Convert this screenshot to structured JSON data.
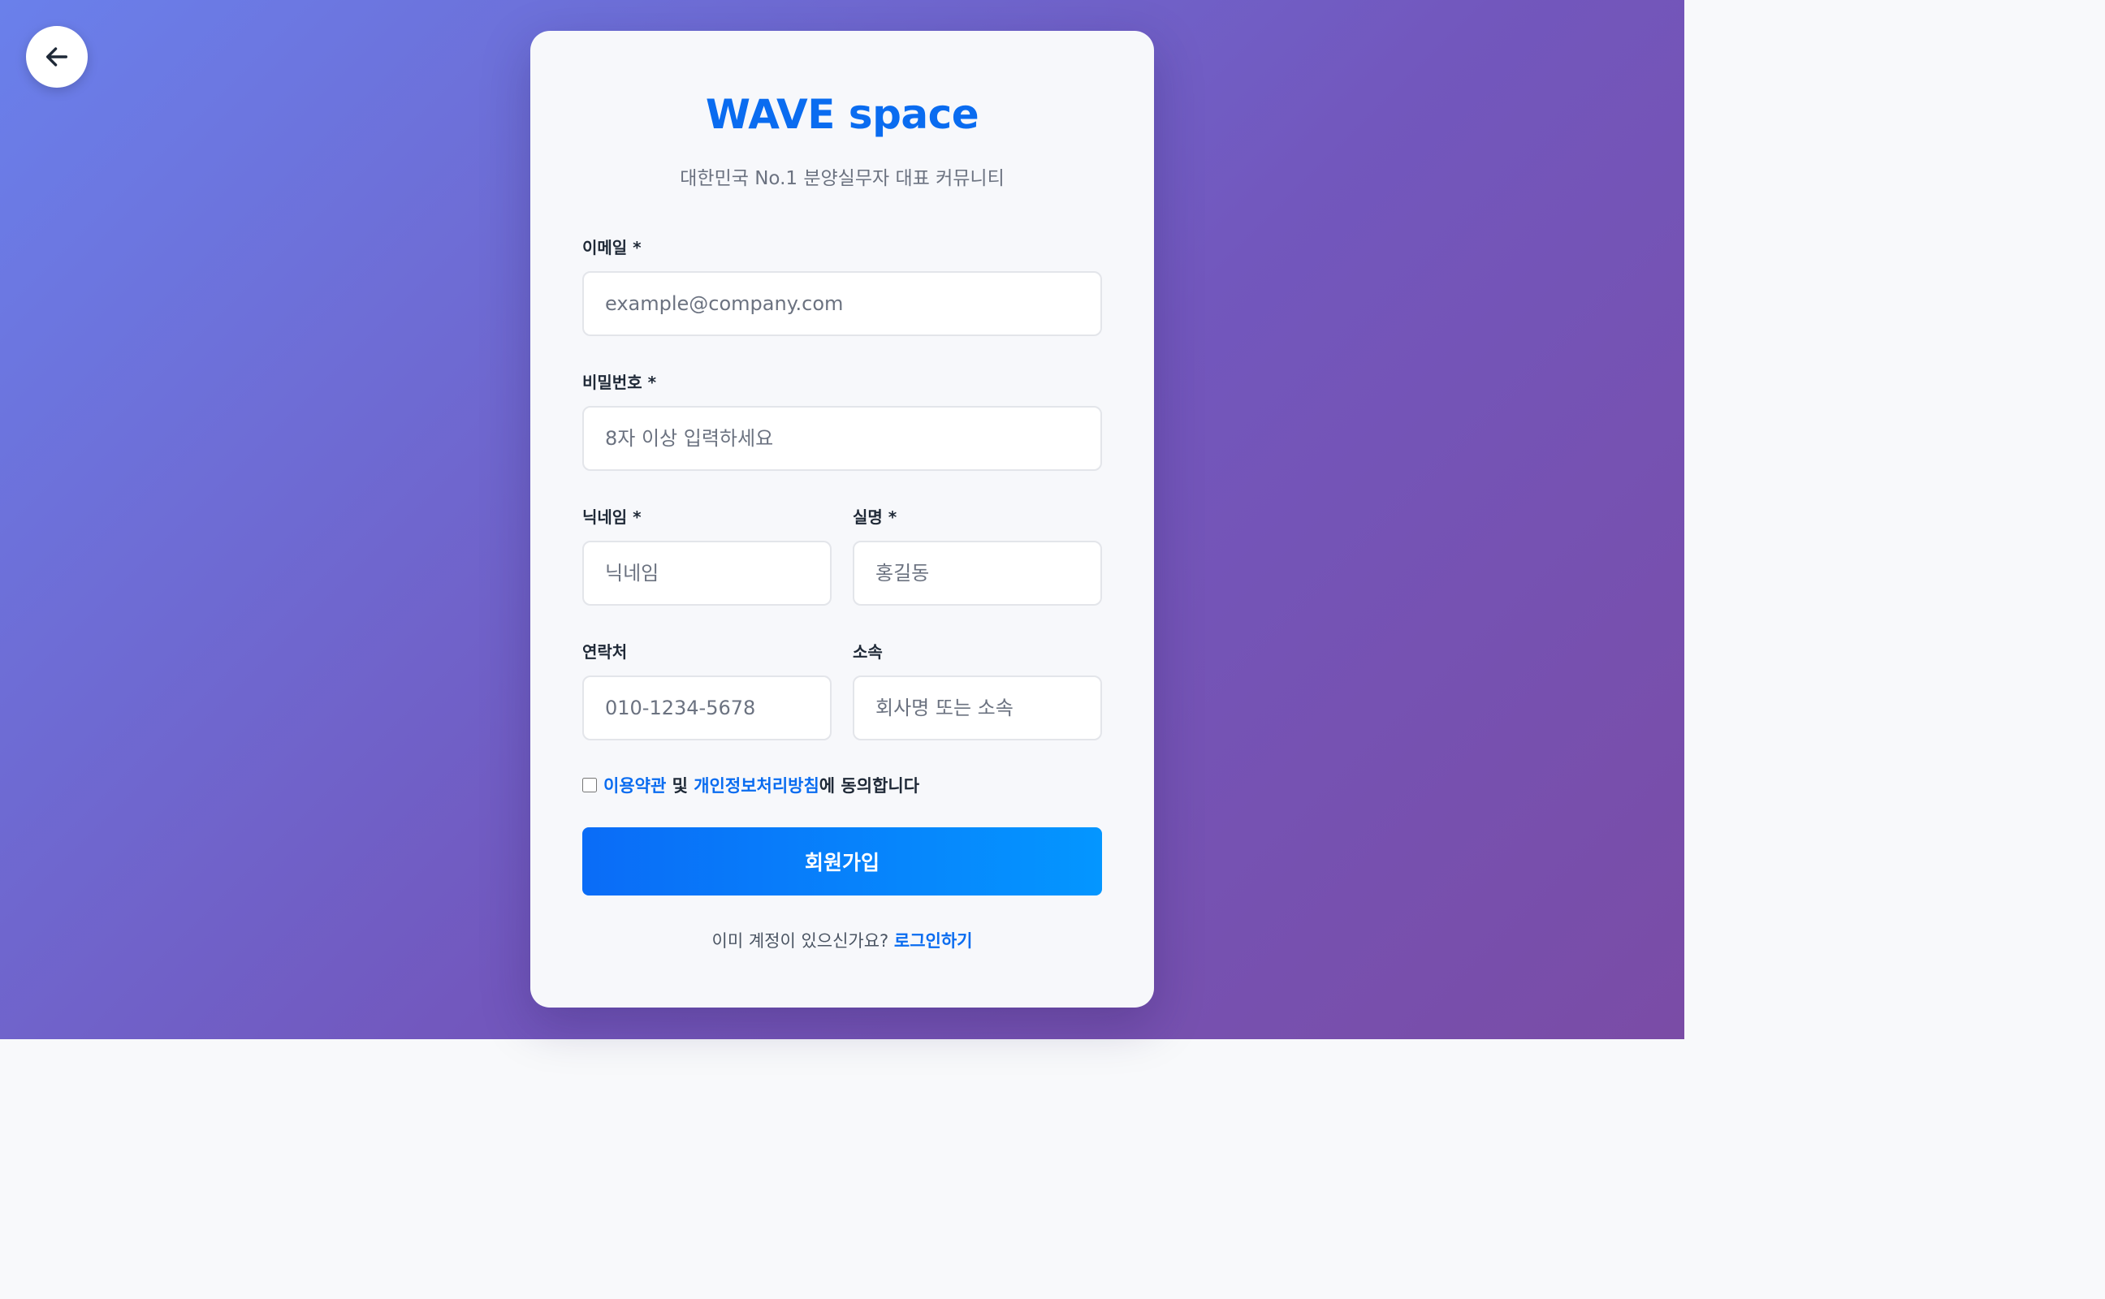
{
  "header": {
    "back_icon": "arrow-left-icon"
  },
  "card": {
    "title": "WAVE space",
    "subtitle": "대한민국 No.1 분양실무자 대표 커뮤니티"
  },
  "form": {
    "email": {
      "label": "이메일 *",
      "placeholder": "example@company.com",
      "value": ""
    },
    "password": {
      "label": "비밀번호 *",
      "placeholder": "8자 이상 입력하세요",
      "value": ""
    },
    "nickname": {
      "label": "닉네임 *",
      "placeholder": "닉네임",
      "value": ""
    },
    "realname": {
      "label": "실명 *",
      "placeholder": "홍길동",
      "value": ""
    },
    "phone": {
      "label": "연락처",
      "placeholder": "010-1234-5678",
      "value": ""
    },
    "affiliation": {
      "label": "소속",
      "placeholder": "회사명 또는 소속",
      "value": ""
    },
    "terms": {
      "checked": false,
      "terms_link": "이용약관",
      "connector": " 및 ",
      "privacy_link": "개인정보처리방침",
      "suffix": "에 동의합니다"
    },
    "submit_label": "회원가입"
  },
  "footer": {
    "prompt": "이미 계정이 있으신가요? ",
    "login_link": "로그인하기"
  },
  "colors": {
    "brand": "#0a6cf0",
    "gradient_start": "#6a80eb",
    "gradient_end": "#7a4ca6",
    "button_start": "#0a6cf7",
    "button_end": "#0496ff"
  }
}
